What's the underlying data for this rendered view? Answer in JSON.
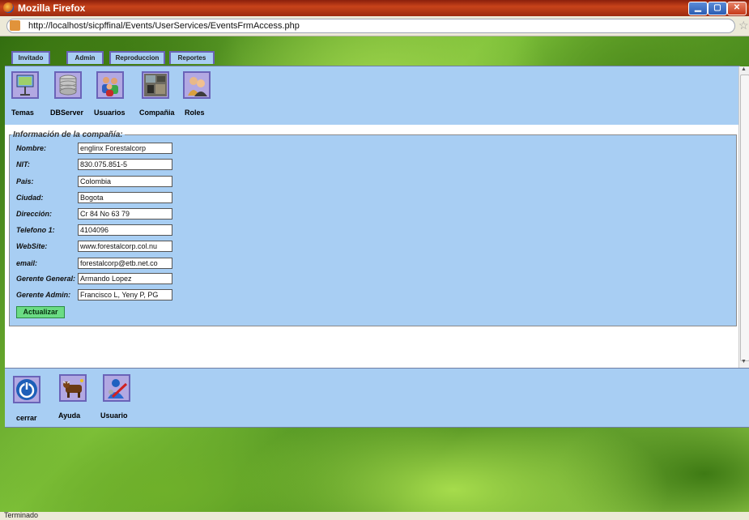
{
  "window": {
    "title": "Mozilla Firefox"
  },
  "browser": {
    "url": "http://localhost/sicpffinal/Events/UserServices/EventsFrmAccess.php",
    "status": "Terminado"
  },
  "tabs": [
    {
      "label": "Invitado"
    },
    {
      "label": "Admin"
    },
    {
      "label": "Reproduccion"
    },
    {
      "label": "Reportes"
    }
  ],
  "toolbar": {
    "items": [
      {
        "label": "Temas",
        "icon": "projector-icon"
      },
      {
        "label": "DBServer",
        "icon": "database-icon"
      },
      {
        "label": "Usuarios",
        "icon": "users-icon"
      },
      {
        "label": "Compañia",
        "icon": "company-photo-icon"
      },
      {
        "label": "Roles",
        "icon": "roles-icon"
      }
    ]
  },
  "company": {
    "legend": "Información de la compañía:",
    "fields": [
      {
        "label": "Nombre:",
        "value": "englinx Forestalcorp"
      },
      {
        "label": "NIT:",
        "value": "830.075.851-5"
      },
      {
        "label": "Pais:",
        "value": "Colombia"
      },
      {
        "label": "Ciudad:",
        "value": "Bogota"
      },
      {
        "label": "Dirección:",
        "value": "Cr 84 No 63 79"
      },
      {
        "label": "Telefono 1:",
        "value": "4104096"
      },
      {
        "label": "WebSite:",
        "value": "www.forestalcorp.col.nu"
      },
      {
        "label": "email:",
        "value": "forestalcorp@etb.net.co"
      },
      {
        "label": "Gerente General:",
        "value": "Armando Lopez"
      },
      {
        "label": "Gerente Admin:",
        "value": "Francisco L, Yeny P,  PG"
      }
    ],
    "submit_label": "Actualizar"
  },
  "bottom_bar": {
    "items": [
      {
        "label": "cerrar",
        "icon": "power-icon"
      },
      {
        "label": "Ayuda",
        "icon": "help-cow-icon"
      },
      {
        "label": "Usuario",
        "icon": "user-tools-icon"
      }
    ]
  },
  "colors": {
    "panel": "#a8cef3",
    "tool_bg": "#b2a8e2",
    "tool_border": "#6a63b8",
    "button": "#6bdc84"
  }
}
